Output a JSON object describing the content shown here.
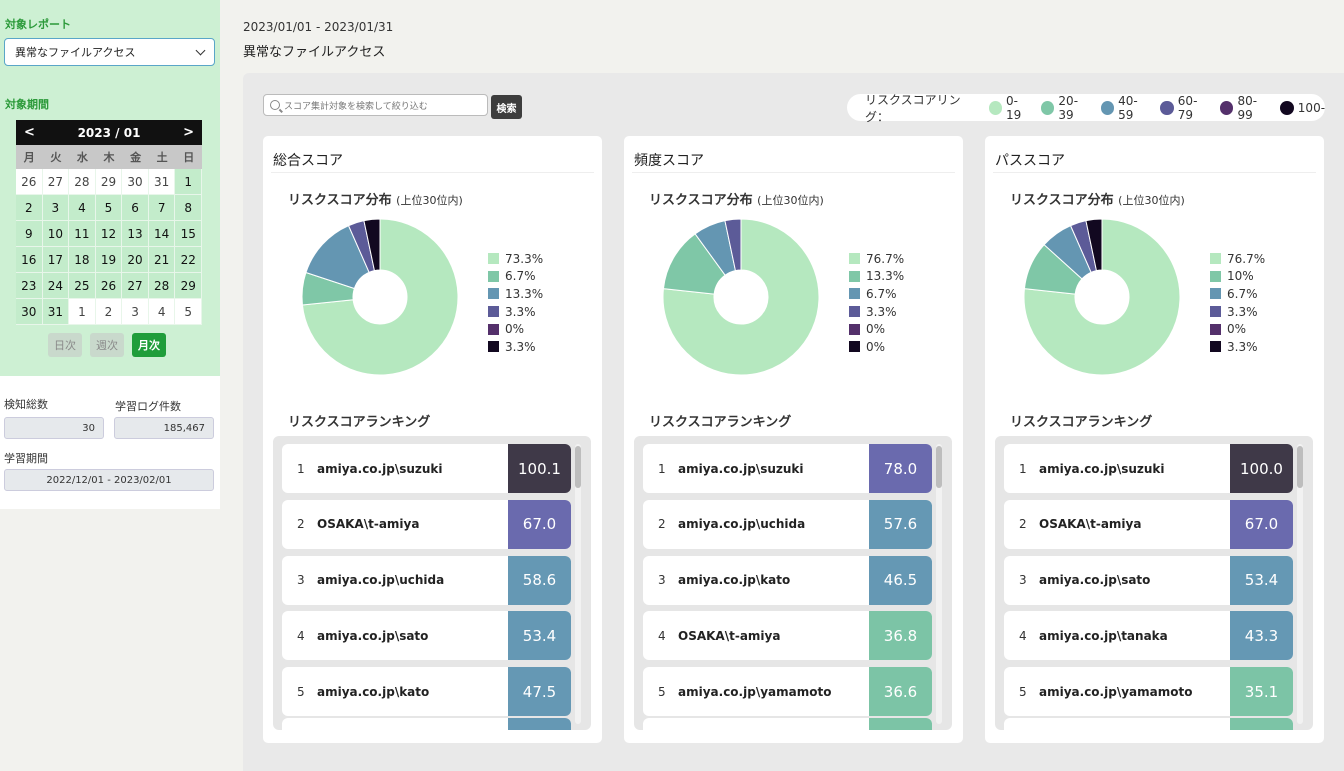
{
  "sidebar": {
    "report_label": "対象レポート",
    "report_value": "異常なファイルアクセス",
    "period_label": "対象期間",
    "calendar": {
      "month": "2023 / 01",
      "prev": "<",
      "next": ">",
      "weekdays": [
        "月",
        "火",
        "水",
        "木",
        "金",
        "土",
        "日"
      ],
      "days": [
        {
          "d": "26",
          "cur": false
        },
        {
          "d": "27",
          "cur": false
        },
        {
          "d": "28",
          "cur": false
        },
        {
          "d": "29",
          "cur": false
        },
        {
          "d": "30",
          "cur": false
        },
        {
          "d": "31",
          "cur": false
        },
        {
          "d": "1",
          "cur": true
        },
        {
          "d": "2",
          "cur": true
        },
        {
          "d": "3",
          "cur": true
        },
        {
          "d": "4",
          "cur": true
        },
        {
          "d": "5",
          "cur": true
        },
        {
          "d": "6",
          "cur": true
        },
        {
          "d": "7",
          "cur": true
        },
        {
          "d": "8",
          "cur": true
        },
        {
          "d": "9",
          "cur": true
        },
        {
          "d": "10",
          "cur": true
        },
        {
          "d": "11",
          "cur": true
        },
        {
          "d": "12",
          "cur": true
        },
        {
          "d": "13",
          "cur": true
        },
        {
          "d": "14",
          "cur": true
        },
        {
          "d": "15",
          "cur": true
        },
        {
          "d": "16",
          "cur": true
        },
        {
          "d": "17",
          "cur": true
        },
        {
          "d": "18",
          "cur": true
        },
        {
          "d": "19",
          "cur": true
        },
        {
          "d": "20",
          "cur": true
        },
        {
          "d": "21",
          "cur": true
        },
        {
          "d": "22",
          "cur": true
        },
        {
          "d": "23",
          "cur": true
        },
        {
          "d": "24",
          "cur": true
        },
        {
          "d": "25",
          "cur": true
        },
        {
          "d": "26",
          "cur": true
        },
        {
          "d": "27",
          "cur": true
        },
        {
          "d": "28",
          "cur": true
        },
        {
          "d": "29",
          "cur": true
        },
        {
          "d": "30",
          "cur": true
        },
        {
          "d": "31",
          "cur": true
        },
        {
          "d": "1",
          "cur": false
        },
        {
          "d": "2",
          "cur": false
        },
        {
          "d": "3",
          "cur": false
        },
        {
          "d": "4",
          "cur": false
        },
        {
          "d": "5",
          "cur": false
        }
      ],
      "modes": [
        {
          "label": "日次",
          "active": false
        },
        {
          "label": "週次",
          "active": false
        },
        {
          "label": "月次",
          "active": true
        }
      ]
    },
    "detect_total_label": "検知総数",
    "detect_total_value": "30",
    "learn_log_label": "学習ログ件数",
    "learn_log_value": "185,467",
    "learn_period_label": "学習期間",
    "learn_period_value": "2022/12/01 - 2023/02/01"
  },
  "header": {
    "date_range": "2023/01/01 - 2023/01/31",
    "title": "異常なファイルアクセス"
  },
  "search": {
    "placeholder": "スコア集計対象を検索して絞り込む",
    "button": "検索"
  },
  "legend": {
    "title": "リスクスコアリング：",
    "items": [
      {
        "label": "0-19",
        "color": "#b5e8bf"
      },
      {
        "label": "20-39",
        "color": "#7fc7a7"
      },
      {
        "label": "40-59",
        "color": "#6496b2"
      },
      {
        "label": "60-79",
        "color": "#5c5b98"
      },
      {
        "label": "80-99",
        "color": "#54306b"
      },
      {
        "label": "100-",
        "color": "#120820"
      }
    ]
  },
  "cards": [
    {
      "title": "総合スコア",
      "dist_title": "リスクスコア分布",
      "dist_note": "(上位30位内)",
      "ranking_title": "リスクスコアランキング",
      "dist_labels": [
        "73.3%",
        "6.7%",
        "13.3%",
        "3.3%",
        "0%",
        "3.3%"
      ],
      "dist_values": [
        73.3,
        6.7,
        13.3,
        3.3,
        0,
        3.3
      ],
      "ranking": [
        {
          "rank": "1",
          "name": "amiya.co.jp\\suzuki",
          "score": "100.1",
          "color": "#3f3948"
        },
        {
          "rank": "2",
          "name": "OSAKA\\t-amiya",
          "score": "67.0",
          "color": "#6a6aae"
        },
        {
          "rank": "3",
          "name": "amiya.co.jp\\uchida",
          "score": "58.6",
          "color": "#6598b4"
        },
        {
          "rank": "4",
          "name": "amiya.co.jp\\sato",
          "score": "53.4",
          "color": "#6598b4"
        },
        {
          "rank": "5",
          "name": "amiya.co.jp\\kato",
          "score": "47.5",
          "color": "#6598b4"
        }
      ],
      "peek_color": "#6598b4"
    },
    {
      "title": "頻度スコア",
      "dist_title": "リスクスコア分布",
      "dist_note": "(上位30位内)",
      "ranking_title": "リスクスコアランキング",
      "dist_labels": [
        "76.7%",
        "13.3%",
        "6.7%",
        "3.3%",
        "0%",
        "0%"
      ],
      "dist_values": [
        76.7,
        13.3,
        6.7,
        3.3,
        0,
        0
      ],
      "ranking": [
        {
          "rank": "1",
          "name": "amiya.co.jp\\suzuki",
          "score": "78.0",
          "color": "#6a6aae"
        },
        {
          "rank": "2",
          "name": "amiya.co.jp\\uchida",
          "score": "57.6",
          "color": "#6598b4"
        },
        {
          "rank": "3",
          "name": "amiya.co.jp\\kato",
          "score": "46.5",
          "color": "#6598b4"
        },
        {
          "rank": "4",
          "name": "OSAKA\\t-amiya",
          "score": "36.8",
          "color": "#7cc4a6"
        },
        {
          "rank": "5",
          "name": "amiya.co.jp\\yamamoto",
          "score": "36.6",
          "color": "#7cc4a6"
        }
      ],
      "peek_color": "#7cc4a6"
    },
    {
      "title": "パススコア",
      "dist_title": "リスクスコア分布",
      "dist_note": "(上位30位内)",
      "ranking_title": "リスクスコアランキング",
      "dist_labels": [
        "76.7%",
        "10%",
        "6.7%",
        "3.3%",
        "0%",
        "3.3%"
      ],
      "dist_values": [
        76.7,
        10,
        6.7,
        3.3,
        0,
        3.3
      ],
      "ranking": [
        {
          "rank": "1",
          "name": "amiya.co.jp\\suzuki",
          "score": "100.0",
          "color": "#3f3948"
        },
        {
          "rank": "2",
          "name": "OSAKA\\t-amiya",
          "score": "67.0",
          "color": "#6a6aae"
        },
        {
          "rank": "3",
          "name": "amiya.co.jp\\sato",
          "score": "53.4",
          "color": "#6598b4"
        },
        {
          "rank": "4",
          "name": "amiya.co.jp\\tanaka",
          "score": "43.3",
          "color": "#6598b4"
        },
        {
          "rank": "5",
          "name": "amiya.co.jp\\yamamoto",
          "score": "35.1",
          "color": "#7cc4a6"
        }
      ],
      "peek_color": "#7cc4a6"
    }
  ]
}
